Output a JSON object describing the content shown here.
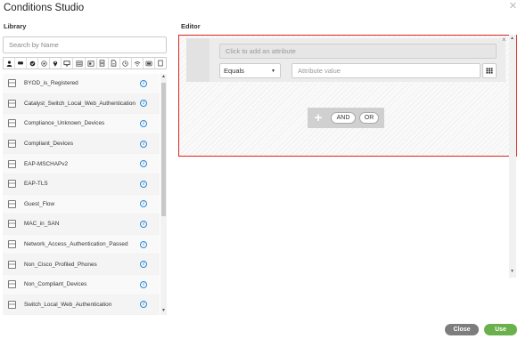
{
  "dialog": {
    "title": "Conditions Studio",
    "close_icon": "close-icon"
  },
  "library": {
    "label": "Library",
    "search_placeholder": "Search by Name",
    "filter_icons": [
      "user-icon",
      "group-icon",
      "shield-icon",
      "target-icon",
      "location-icon",
      "monitor-icon",
      "list-icon",
      "card-icon",
      "server-icon",
      "document-icon",
      "clock-icon",
      "wifi-icon",
      "device-icon",
      "page-icon"
    ],
    "items": [
      {
        "name": "BYOD_is_Registered"
      },
      {
        "name": "Catalyst_Switch_Local_Web_Authentication"
      },
      {
        "name": "Compliance_Unknown_Devices"
      },
      {
        "name": "Compliant_Devices"
      },
      {
        "name": "EAP-MSCHAPv2"
      },
      {
        "name": "EAP-TLS"
      },
      {
        "name": "Guest_Flow"
      },
      {
        "name": "MAC_in_SAN"
      },
      {
        "name": "Network_Access_Authentication_Passed"
      },
      {
        "name": "Non_Cisco_Profiled_Phones"
      },
      {
        "name": "Non_Compliant_Devices"
      },
      {
        "name": "Switch_Local_Web_Authentication"
      }
    ]
  },
  "editor": {
    "label": "Editor",
    "attribute_placeholder": "Click to add an attribute",
    "operator": "Equals",
    "value_placeholder": "Attribute value",
    "and_label": "AND",
    "or_label": "OR",
    "accent_color": "#d9261c"
  },
  "footer": {
    "close_label": "Close",
    "use_label": "Use",
    "use_color": "#6ab04c"
  }
}
